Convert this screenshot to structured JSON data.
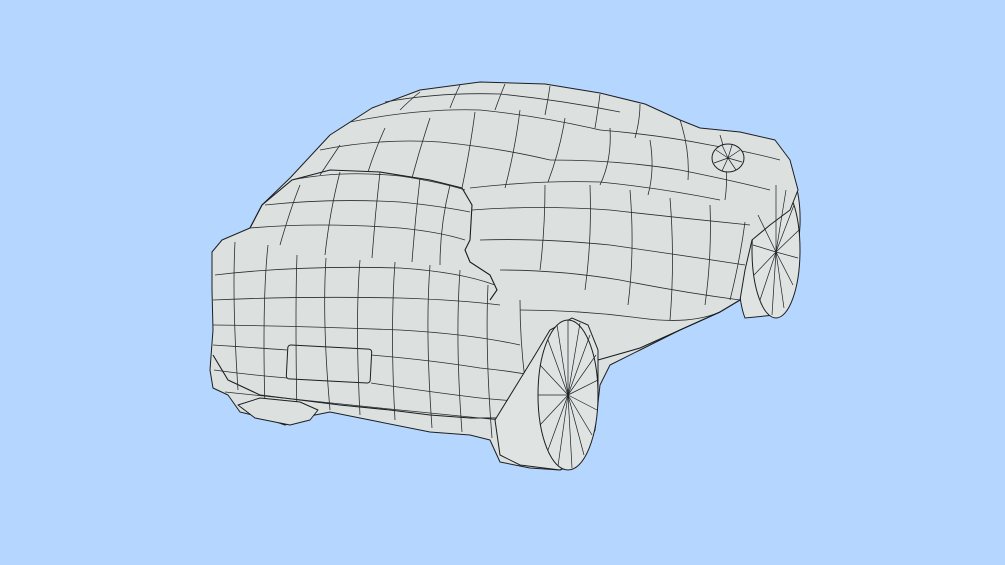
{
  "viewport": {
    "background_color": "#b5d6ff",
    "mesh_fill_color": "#dce1e0",
    "wire_color": "#1d1f20"
  },
  "scene": {
    "object": "car-wireframe-mesh",
    "shading": "flat-with-wireframe"
  }
}
